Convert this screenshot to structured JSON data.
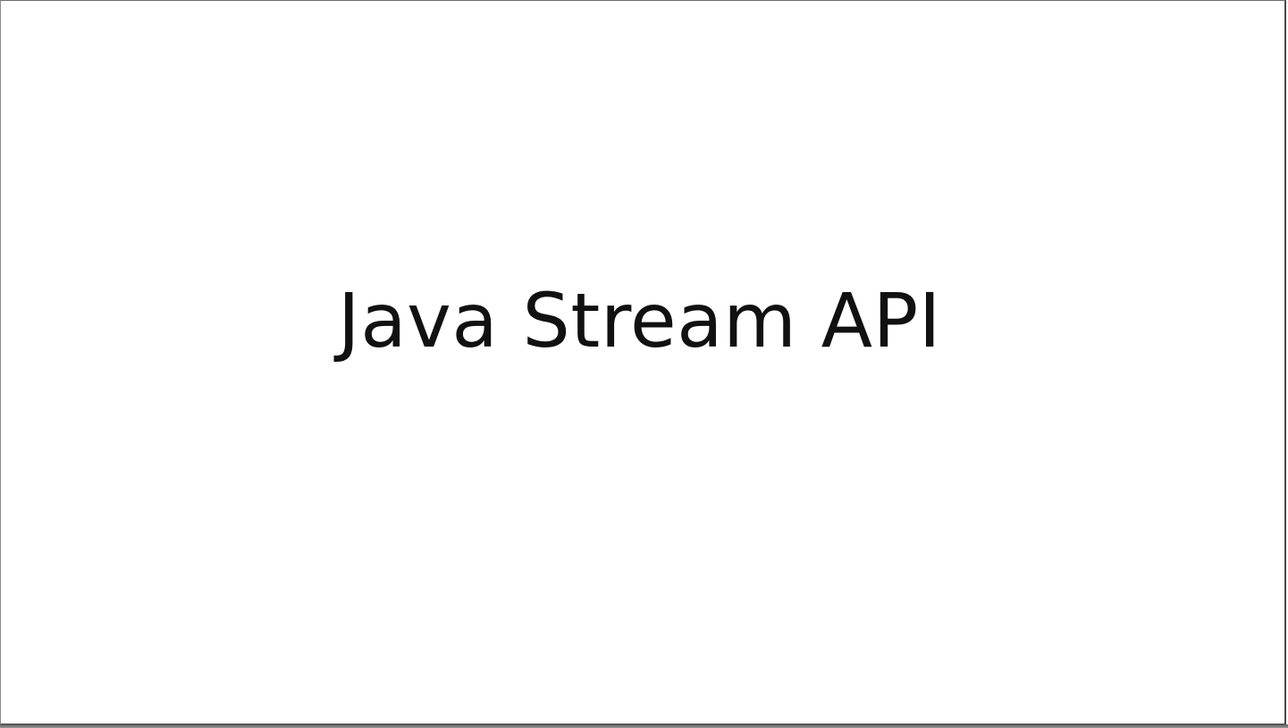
{
  "slide": {
    "title": "Java Stream API"
  }
}
